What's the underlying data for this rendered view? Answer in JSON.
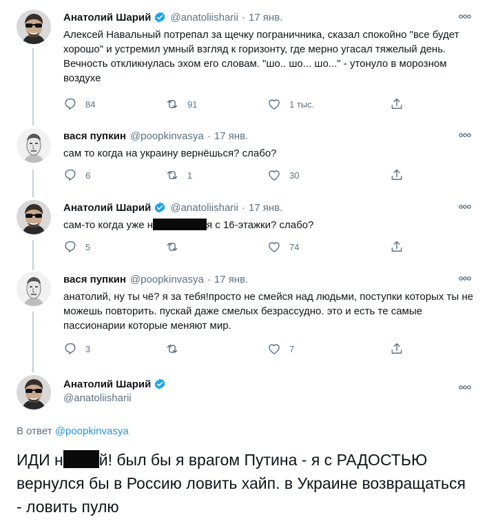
{
  "colors": {
    "accent": "#1da1f2",
    "muted": "#5b7083",
    "line": "#c4cfd6"
  },
  "tweets": [
    {
      "name": "Анатолий Шарий",
      "verified": true,
      "handle": "@anatoliisharii",
      "date": "17 янв.",
      "text": "Алексей Навальный потрепал за щечку пограничника, сказал спокойно \"все будет хорошо\" и устремил умный взгляд к горизонту, где мерно угасал тяжелый день. Вечность откликнулась эхом его словам. \"шо.. шо... шо...\" - утонуло в морозном воздухе",
      "replies": "84",
      "retweets": "91",
      "likes": "1 тыс."
    },
    {
      "name": "вася пупкин",
      "verified": false,
      "handle": "@poopkinvasya",
      "date": "17 янв.",
      "text": "сам то когда на украину вернёшься? слабо?",
      "replies": "6",
      "retweets": "1",
      "likes": "30"
    },
    {
      "name": "Анатолий Шарий",
      "verified": true,
      "handle": "@anatoliisharii",
      "date": "17 янв.",
      "text_before": "сам-то когда уже н",
      "text_after": "я с 16-этажки? слабо?",
      "replies": "5",
      "retweets": "",
      "likes": "74"
    },
    {
      "name": "вася пупкин",
      "verified": false,
      "handle": "@poopkinvasya",
      "date": "17 янв.",
      "text": "анатолий, ну ты чё? я за тебя!просто не смейся над людьми, поступки которых ты не можешь повторить. пускай даже смелых безрассудно. это и есть те самые пассионарии которые меняют мир.",
      "replies": "3",
      "retweets": "",
      "likes": "7"
    }
  ],
  "main_tweet": {
    "name": "Анатолий Шарий",
    "verified": true,
    "handle": "@anatoliisharii",
    "reply_prefix": "В ответ ",
    "reply_to": "@poopkinvasya",
    "text_before": "ИДИ н",
    "text_after": "й! был бы я врагом Путина - я с РАДОСТЬЮ вернулся бы в Россию ловить хайп. в Украине возвращаться - ловить пулю"
  },
  "icons": {
    "reply": "reply-icon",
    "retweet": "retweet-icon",
    "like": "heart-icon",
    "share": "share-icon",
    "more": "more-icon",
    "verified": "verified-badge-icon"
  }
}
